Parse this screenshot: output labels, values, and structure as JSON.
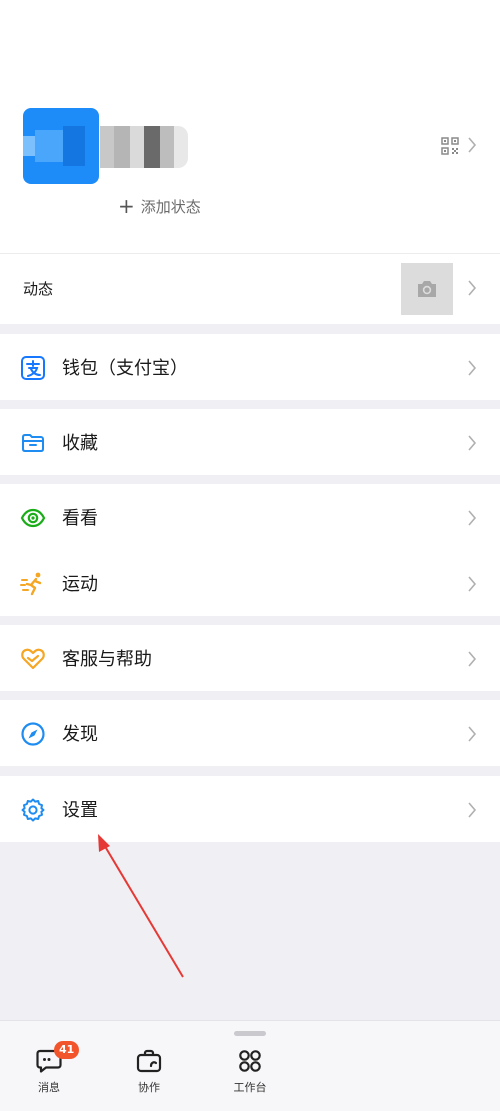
{
  "profile": {
    "add_status_icon": "plus-icon",
    "add_status_label": "添加状态",
    "qr_icon": "qr-code-icon"
  },
  "moments": {
    "label": "动态",
    "camera_icon": "camera-icon"
  },
  "menu": {
    "wallet": {
      "label": "钱包（支付宝）",
      "icon": "alipay-icon",
      "color": "#1677ff"
    },
    "favorites": {
      "label": "收藏",
      "icon": "folder-icon",
      "color": "#1e8cf0"
    },
    "watch": {
      "label": "看看",
      "icon": "eye-icon",
      "color": "#1aad19"
    },
    "sports": {
      "label": "运动",
      "icon": "running-icon",
      "color": "#f5a623"
    },
    "support": {
      "label": "客服与帮助",
      "icon": "heart-help-icon",
      "color": "#f5a623"
    },
    "discover": {
      "label": "发现",
      "icon": "compass-icon",
      "color": "#1e8cf0"
    },
    "settings": {
      "label": "设置",
      "icon": "gear-icon",
      "color": "#1e8cf0"
    }
  },
  "bottom_nav": {
    "messages": {
      "label": "消息",
      "badge": "41",
      "icon": "chat-bubble-icon"
    },
    "collaborate": {
      "label": "协作",
      "icon": "briefcase-icon"
    },
    "workbench": {
      "label": "工作台",
      "icon": "grid-apps-icon"
    }
  },
  "colors": {
    "background": "#f0eff4",
    "card": "#ffffff",
    "badge": "#f2552c",
    "annotation_arrow": "#e53935"
  }
}
